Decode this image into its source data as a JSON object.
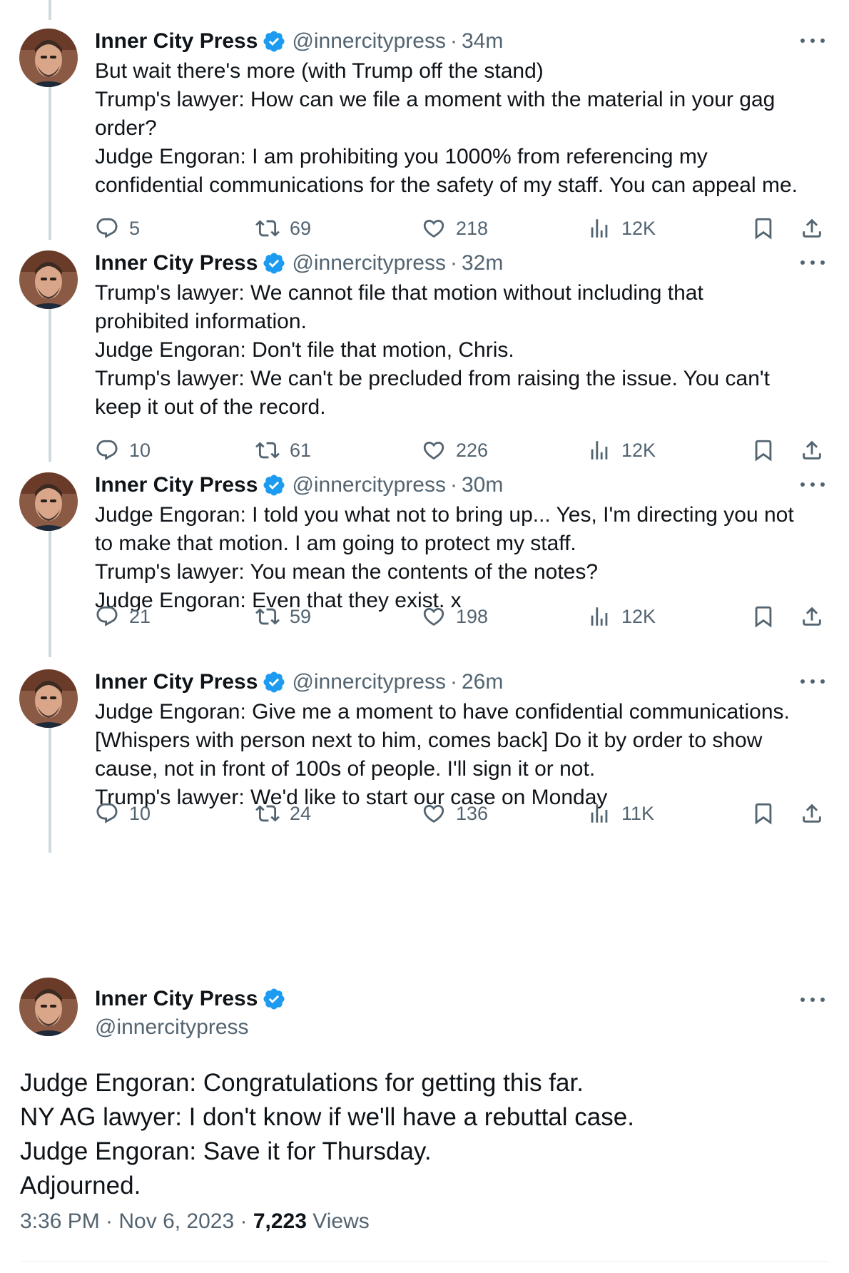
{
  "colors": {
    "text": "#0f1419",
    "secondary": "#536471",
    "verified": "#1d9bf0",
    "thread_line": "#cfd9de"
  },
  "account": {
    "name": "Inner City Press",
    "handle": "@innercitypress",
    "verified": true
  },
  "thread": [
    {
      "time": "34m",
      "lines": [
        "But wait there's more (with Trump off the stand)",
        "Trump's lawyer: How can we file a moment with the material in your gag",
        "order?",
        "Judge Engoran: I am prohibiting you 1000% from referencing my",
        "confidential communications for the safety of my staff. You can appeal me."
      ],
      "replies": "5",
      "reposts": "69",
      "likes": "218",
      "views": "12K"
    },
    {
      "time": "32m",
      "lines": [
        "Trump's lawyer: We cannot file that motion without including that",
        "prohibited information.",
        "Judge Engoran: Don't file that motion, Chris.",
        "Trump's lawyer: We can't be precluded from raising the issue. You can't",
        "keep it out of the record."
      ],
      "replies": "10",
      "reposts": "61",
      "likes": "226",
      "views": "12K"
    },
    {
      "time": "30m",
      "lines": [
        "Judge Engoran: I told you what not to bring up... Yes, I'm directing you not",
        "to make that motion. I am going to protect my staff.",
        "Trump's lawyer: You mean the contents of the notes?",
        "Judge Engoran: Even that they exist. x"
      ],
      "replies": "21",
      "reposts": "59",
      "likes": "198",
      "views": "12K"
    },
    {
      "time": "26m",
      "lines": [
        "Judge Engoran: Give me a moment to have confidential communications.",
        "[Whispers with person next to him, comes back] Do it by order to show",
        "cause, not in front of 100s of people. I'll sign it or not.",
        "Trump's lawyer: We'd like to start our case on Monday"
      ],
      "replies": "10",
      "reposts": "24",
      "likes": "136",
      "views": "11K"
    }
  ],
  "main_tweet": {
    "lines": [
      "Judge Engoran: Congratulations for getting this far.",
      "NY AG lawyer: I don't know if we'll have a rebuttal case.",
      "Judge Engoran: Save it for Thursday.",
      "Adjourned."
    ],
    "timestamp": "3:36 PM · Nov 6, 2023 · ",
    "views_count": "7,223",
    "views_label": "Views"
  },
  "icons": {
    "reply": "reply-icon",
    "repost": "repost-icon",
    "like": "heart-icon",
    "views": "views-chart-icon",
    "bookmark": "bookmark-icon",
    "share": "share-icon",
    "verified": "verified-badge-icon",
    "more": "more-options-icon"
  }
}
